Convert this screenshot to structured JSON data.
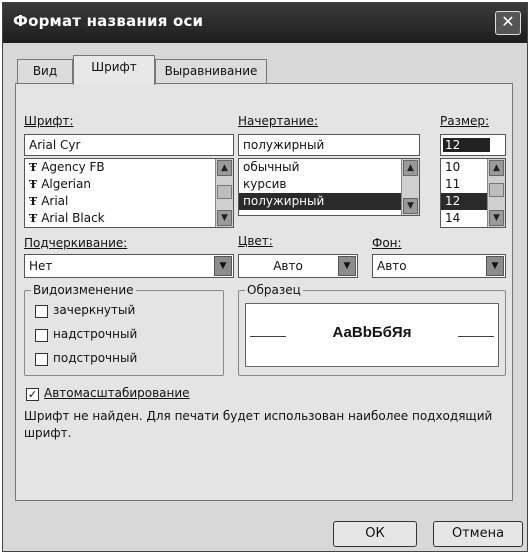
{
  "window": {
    "title": "Формат названия оси",
    "close_glyph": "✕"
  },
  "tabs": [
    {
      "label": "Вид"
    },
    {
      "label": "Шрифт"
    },
    {
      "label": "Выравнивание"
    }
  ],
  "font": {
    "label": "Шрифт:",
    "value": "Arial Cyr",
    "items": [
      {
        "label": "Agency FB"
      },
      {
        "label": "Algerian"
      },
      {
        "label": "Arial"
      },
      {
        "label": "Arial Black"
      }
    ],
    "item_icon_glyph": "Ŧ"
  },
  "style": {
    "label": "Начертание:",
    "value": "полужирный",
    "items": [
      {
        "label": "обычный"
      },
      {
        "label": "курсив"
      },
      {
        "label": "полужирный"
      }
    ]
  },
  "size": {
    "label": "Размер:",
    "value": "12",
    "items": [
      {
        "label": "10"
      },
      {
        "label": "11"
      },
      {
        "label": "12"
      },
      {
        "label": "14"
      }
    ]
  },
  "underline": {
    "label": "Подчеркивание:",
    "value": "Нет"
  },
  "color": {
    "label": "Цвет:",
    "value": "Авто"
  },
  "background": {
    "label": "Фон:",
    "value": "Авто"
  },
  "effects": {
    "label": "Видоизменение",
    "items": [
      {
        "label": "зачеркнутый",
        "checked": false
      },
      {
        "label": "надстрочный",
        "checked": false
      },
      {
        "label": "подстрочный",
        "checked": false
      }
    ]
  },
  "preview": {
    "label": "Образец",
    "text": "АаВbБбЯя"
  },
  "autoscale": {
    "label": "Автомасштабирование",
    "checked": true,
    "check_glyph": "✓"
  },
  "note": "Шрифт не найден. Для печати будет использован наиболее подходящий шрифт.",
  "buttons": {
    "ok": "ОК",
    "cancel": "Отмена"
  },
  "glyphs": {
    "up": "▲",
    "down": "▼"
  }
}
